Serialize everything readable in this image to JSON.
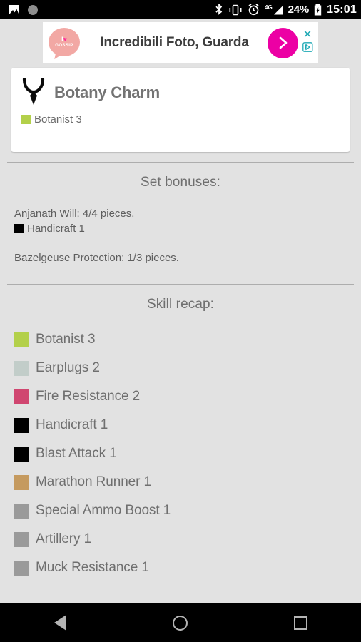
{
  "statusbar": {
    "icons_left": [
      "photo-icon",
      "disc-icon"
    ],
    "icons_right": [
      "bluetooth-icon",
      "vibrate-icon",
      "alarm-icon",
      "signal-4g-icon",
      "battery-charging-icon"
    ],
    "network_label": "4G",
    "battery_percent": "24%",
    "time": "15:01"
  },
  "ad": {
    "logo_line1": "I",
    "logo_heart": "♥",
    "logo_line2": "GOSSIP",
    "text": "Incredibili Foto, Guarda",
    "cta_icon": "chevron-right-icon",
    "close_label": "✕",
    "adchoices_icon": "adchoices-icon"
  },
  "charm_card": {
    "icon": "necklace-charm-icon",
    "title": "Botany Charm",
    "skill": {
      "label": "Botanist 3",
      "color": "#b3d04a"
    }
  },
  "set_bonuses": {
    "heading": "Set bonuses:",
    "entries": [
      {
        "title": "Anjanath Will: 4/4 pieces.",
        "skill": {
          "label": "Handicraft 1",
          "color": "#000000"
        }
      },
      {
        "title": "Bazelgeuse Protection: 1/3 pieces.",
        "skill": null
      }
    ]
  },
  "skill_recap": {
    "heading": "Skill recap:",
    "skills": [
      {
        "label": "Botanist 3",
        "color": "#b3d04a"
      },
      {
        "label": "Earplugs 2",
        "color": "#c2cdc9"
      },
      {
        "label": "Fire Resistance 2",
        "color": "#d04670"
      },
      {
        "label": "Handicraft 1",
        "color": "#000000"
      },
      {
        "label": "Blast Attack 1",
        "color": "#000000"
      },
      {
        "label": "Marathon Runner 1",
        "color": "#c59a5f"
      },
      {
        "label": "Special Ammo Boost 1",
        "color": "#9a9a9a"
      },
      {
        "label": "Artillery 1",
        "color": "#9a9a9a"
      },
      {
        "label": "Muck Resistance 1",
        "color": "#9a9a9a"
      }
    ]
  },
  "navbar": {
    "back": "back-button",
    "home": "home-button",
    "recents": "recents-button"
  }
}
